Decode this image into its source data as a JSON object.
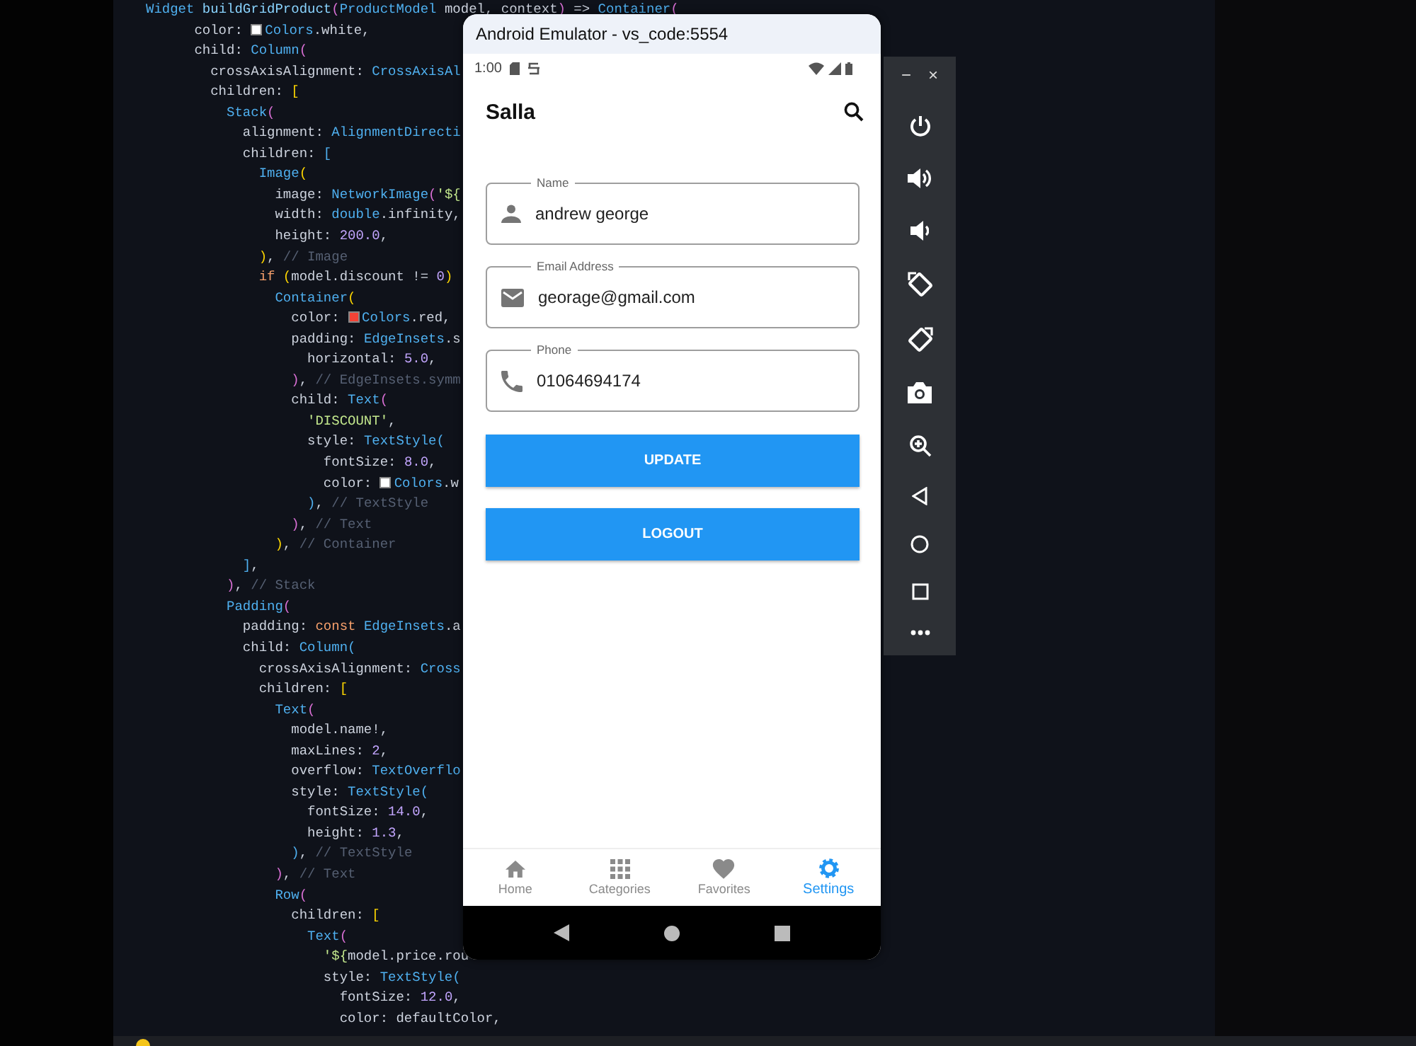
{
  "editor": {
    "lines": [
      [
        {
          "text": "Widget ",
          "kind": "t"
        },
        {
          "text": "buildGridProduct",
          "kind": "f"
        },
        {
          "text": "(",
          "kind": "b"
        },
        {
          "text": "ProductModel",
          "kind": "t"
        },
        {
          "text": " model, context",
          "kind": "p"
        },
        {
          "text": ")",
          "kind": "b"
        },
        {
          "text": " => ",
          "kind": "p"
        },
        {
          "text": "Container",
          "kind": "t"
        },
        {
          "text": "(",
          "kind": "b"
        }
      ],
      [
        {
          "text": "      color: ",
          "kind": "p"
        },
        {
          "kind": "sw",
          "color": "#ffffff"
        },
        {
          "text": "Colors",
          "kind": "t"
        },
        {
          "text": ".white,",
          "kind": "p"
        }
      ],
      [
        {
          "text": "      child: ",
          "kind": "p"
        },
        {
          "text": "Column",
          "kind": "t"
        },
        {
          "text": "(",
          "kind": "b"
        }
      ],
      [
        {
          "text": "        crossAxisAlignment: ",
          "kind": "p"
        },
        {
          "text": "CrossAxisAl",
          "kind": "t"
        }
      ],
      [
        {
          "text": "        children: ",
          "kind": "p"
        },
        {
          "text": "[",
          "kind": "y"
        }
      ],
      [
        {
          "text": "          Stack",
          "kind": "t"
        },
        {
          "text": "(",
          "kind": "b"
        }
      ],
      [
        {
          "text": "            alignment: ",
          "kind": "p"
        },
        {
          "text": "AlignmentDirecti",
          "kind": "t"
        }
      ],
      [
        {
          "text": "            children: ",
          "kind": "p"
        },
        {
          "text": "[",
          "kind": "t"
        }
      ],
      [
        {
          "text": "              Image",
          "kind": "t"
        },
        {
          "text": "(",
          "kind": "y"
        }
      ],
      [
        {
          "text": "                image: ",
          "kind": "p"
        },
        {
          "text": "NetworkImage",
          "kind": "t"
        },
        {
          "text": "(",
          "kind": "b"
        },
        {
          "text": "'${",
          "kind": "s"
        }
      ],
      [
        {
          "text": "                width: ",
          "kind": "p"
        },
        {
          "text": "double",
          "kind": "t"
        },
        {
          "text": ".infinity,",
          "kind": "p"
        }
      ],
      [
        {
          "text": "                height: ",
          "kind": "p"
        },
        {
          "text": "200.0",
          "kind": "n"
        },
        {
          "text": ",",
          "kind": "p"
        }
      ],
      [
        {
          "text": "              )",
          "kind": "y"
        },
        {
          "text": ", ",
          "kind": "p"
        },
        {
          "text": "// Image",
          "kind": "c"
        }
      ],
      [
        {
          "text": "              if",
          "kind": "k"
        },
        {
          "text": " (",
          "kind": "y"
        },
        {
          "text": "model.discount != ",
          "kind": "p"
        },
        {
          "text": "0",
          "kind": "n"
        },
        {
          "text": ")",
          "kind": "y"
        }
      ],
      [
        {
          "text": "                Container",
          "kind": "t"
        },
        {
          "text": "(",
          "kind": "y"
        }
      ],
      [
        {
          "text": "                  color: ",
          "kind": "p"
        },
        {
          "kind": "sw",
          "color": "#f44336"
        },
        {
          "text": "Colors",
          "kind": "t"
        },
        {
          "text": ".red,",
          "kind": "p"
        }
      ],
      [
        {
          "text": "                  padding: ",
          "kind": "p"
        },
        {
          "text": "EdgeInsets",
          "kind": "t"
        },
        {
          "text": ".s",
          "kind": "p"
        }
      ],
      [
        {
          "text": "                    horizontal: ",
          "kind": "p"
        },
        {
          "text": "5.0",
          "kind": "n"
        },
        {
          "text": ",",
          "kind": "p"
        }
      ],
      [
        {
          "text": "                  )",
          "kind": "b"
        },
        {
          "text": ", ",
          "kind": "p"
        },
        {
          "text": "// EdgeInsets.symm",
          "kind": "c"
        }
      ],
      [
        {
          "text": "                  child: ",
          "kind": "p"
        },
        {
          "text": "Text",
          "kind": "t"
        },
        {
          "text": "(",
          "kind": "b"
        }
      ],
      [
        {
          "text": "                    'DISCOUNT'",
          "kind": "s"
        },
        {
          "text": ",",
          "kind": "p"
        }
      ],
      [
        {
          "text": "                    style: ",
          "kind": "p"
        },
        {
          "text": "TextStyle",
          "kind": "t"
        },
        {
          "text": "(",
          "kind": "t"
        }
      ],
      [
        {
          "text": "                      fontSize: ",
          "kind": "p"
        },
        {
          "text": "8.0",
          "kind": "n"
        },
        {
          "text": ",",
          "kind": "p"
        }
      ],
      [
        {
          "text": "                      color: ",
          "kind": "p"
        },
        {
          "kind": "sw",
          "color": "#ffffff"
        },
        {
          "text": "Colors",
          "kind": "t"
        },
        {
          "text": ".w",
          "kind": "p"
        }
      ],
      [
        {
          "text": "                    )",
          "kind": "t"
        },
        {
          "text": ", ",
          "kind": "p"
        },
        {
          "text": "// TextStyle",
          "kind": "c"
        }
      ],
      [
        {
          "text": "                  )",
          "kind": "b"
        },
        {
          "text": ", ",
          "kind": "p"
        },
        {
          "text": "// Text",
          "kind": "c"
        }
      ],
      [
        {
          "text": "                )",
          "kind": "y"
        },
        {
          "text": ", ",
          "kind": "p"
        },
        {
          "text": "// Container",
          "kind": "c"
        }
      ],
      [
        {
          "text": "            ]",
          "kind": "t"
        },
        {
          "text": ",",
          "kind": "p"
        }
      ],
      [
        {
          "text": "          )",
          "kind": "b"
        },
        {
          "text": ", ",
          "kind": "p"
        },
        {
          "text": "// Stack",
          "kind": "c"
        }
      ],
      [
        {
          "text": "          Padding",
          "kind": "t"
        },
        {
          "text": "(",
          "kind": "b"
        }
      ],
      [
        {
          "text": "            padding: ",
          "kind": "p"
        },
        {
          "text": "const",
          "kind": "k"
        },
        {
          "text": " EdgeInsets",
          "kind": "t"
        },
        {
          "text": ".a",
          "kind": "p"
        }
      ],
      [
        {
          "text": "            child: ",
          "kind": "p"
        },
        {
          "text": "Column",
          "kind": "t"
        },
        {
          "text": "(",
          "kind": "t"
        }
      ],
      [
        {
          "text": "              crossAxisAlignment: ",
          "kind": "p"
        },
        {
          "text": "Cross",
          "kind": "t"
        }
      ],
      [
        {
          "text": "              children: ",
          "kind": "p"
        },
        {
          "text": "[",
          "kind": "y"
        }
      ],
      [
        {
          "text": "                Text",
          "kind": "t"
        },
        {
          "text": "(",
          "kind": "b"
        }
      ],
      [
        {
          "text": "                  model.name!,",
          "kind": "p"
        }
      ],
      [
        {
          "text": "                  maxLines: ",
          "kind": "p"
        },
        {
          "text": "2",
          "kind": "n"
        },
        {
          "text": ",",
          "kind": "p"
        }
      ],
      [
        {
          "text": "                  overflow: ",
          "kind": "p"
        },
        {
          "text": "TextOverflo",
          "kind": "t"
        }
      ],
      [
        {
          "text": "                  style: ",
          "kind": "p"
        },
        {
          "text": "TextStyle",
          "kind": "t"
        },
        {
          "text": "(",
          "kind": "t"
        }
      ],
      [
        {
          "text": "                    fontSize: ",
          "kind": "p"
        },
        {
          "text": "14.0",
          "kind": "n"
        },
        {
          "text": ",",
          "kind": "p"
        }
      ],
      [
        {
          "text": "                    height: ",
          "kind": "p"
        },
        {
          "text": "1.3",
          "kind": "n"
        },
        {
          "text": ",",
          "kind": "p"
        }
      ],
      [
        {
          "text": "                  )",
          "kind": "t"
        },
        {
          "text": ", ",
          "kind": "p"
        },
        {
          "text": "// TextStyle",
          "kind": "c"
        }
      ],
      [
        {
          "text": "                )",
          "kind": "b"
        },
        {
          "text": ", ",
          "kind": "p"
        },
        {
          "text": "// Text",
          "kind": "c"
        }
      ],
      [
        {
          "text": "                Row",
          "kind": "t"
        },
        {
          "text": "(",
          "kind": "b"
        }
      ],
      [
        {
          "text": "                  children: ",
          "kind": "p"
        },
        {
          "text": "[",
          "kind": "y"
        }
      ],
      [
        {
          "text": "                    Text",
          "kind": "t"
        },
        {
          "text": "(",
          "kind": "b"
        }
      ],
      [
        {
          "text": "                      '${",
          "kind": "s"
        },
        {
          "text": "model.price.rou",
          "kind": "p"
        }
      ],
      [
        {
          "text": "                      style: ",
          "kind": "p"
        },
        {
          "text": "TextStyle",
          "kind": "t"
        },
        {
          "text": "(",
          "kind": "t"
        }
      ],
      [
        {
          "text": "                        fontSize: ",
          "kind": "p"
        },
        {
          "text": "12.0",
          "kind": "n"
        },
        {
          "text": ",",
          "kind": "p"
        }
      ],
      [
        {
          "text": "                        color: defaultColor,",
          "kind": "p"
        }
      ]
    ]
  },
  "emulator": {
    "title": "Android Emulator - vs_code:5554",
    "status_bar": {
      "time": "1:00"
    },
    "app_bar": {
      "title": "Salla"
    },
    "fields": [
      {
        "label": "Name",
        "value": "andrew george",
        "kind": "person"
      },
      {
        "label": "Email Address",
        "value": "georage@gmail.com",
        "kind": "email"
      },
      {
        "label": "Phone",
        "value": "01064694174",
        "kind": "phone"
      }
    ],
    "buttons": [
      "UPDATE",
      "LOGOUT"
    ],
    "bottom_nav": [
      {
        "label": "Home",
        "kind": "home",
        "selected": false
      },
      {
        "label": "Categories",
        "kind": "grid",
        "selected": false
      },
      {
        "label": "Favorites",
        "kind": "heart",
        "selected": false
      },
      {
        "label": "Settings",
        "kind": "gear",
        "selected": true
      }
    ]
  },
  "side_toolbar": {
    "minimize": "−",
    "close": "×"
  }
}
